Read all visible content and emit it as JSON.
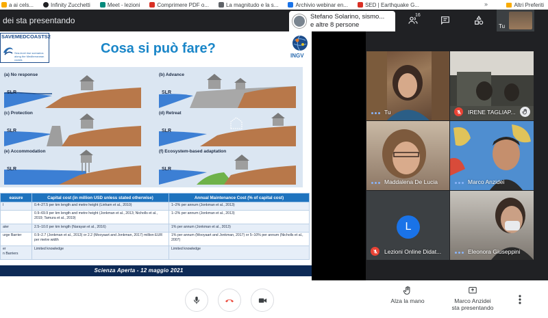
{
  "bookmarks": [
    {
      "label": "a ai cels...",
      "color": "#f9ab00"
    },
    {
      "label": "Infinity Zucchetti",
      "color": "#202124"
    },
    {
      "label": "Meet - lezioni",
      "color": "#00897b"
    },
    {
      "label": "Comprimere PDF o...",
      "color": "#d93025"
    },
    {
      "label": "La magnitudo e la s...",
      "color": "#5f6368"
    },
    {
      "label": "Archivio webinar en...",
      "color": "#1a73e8"
    },
    {
      "label": "SED | Earthquake G...",
      "color": "#d93025"
    }
  ],
  "bookmarks_more": "»",
  "bookmarks_other": "Altri Preferiti",
  "header": {
    "presenting_title": "dei sta presentando",
    "presenter_line1": "Stefano Solarino, sismo...",
    "presenter_line2": "e altre 8 persone",
    "people_count": "16",
    "self_label": "Tu"
  },
  "slide": {
    "title": "Cosa si può fare?",
    "logo_title": "SAVEMEDCOASTS2",
    "logo_sub": "Sea-level rise scenarios along the Mediterranean coasts",
    "ingv_label": "INGV",
    "panels": [
      {
        "label": "(a) No response",
        "slr": "SLR"
      },
      {
        "label": "(b) Advance",
        "slr": "SLR"
      },
      {
        "label": "(c) Protection",
        "slr": "SLR"
      },
      {
        "label": "(d) Retreat",
        "slr": "SLR"
      },
      {
        "label": "(e) Accommodation",
        "slr": "SLR"
      },
      {
        "label": "(f) Ecosystem-based adaptation",
        "slr": "SLR"
      }
    ],
    "table": {
      "headers": [
        "easure",
        "Capital cost (in million USD unless stated otherwise)",
        "Annual Maintenance Cost (% of capital cost)"
      ],
      "rows": [
        [
          "l",
          "0.4–27.5 per km length and metre height (Linham et al., 2010)",
          "1–2% per annum (Jonkman et al., 2013)"
        ],
        [
          "",
          "0.9–69.9 per km length and metre height (Jonkman et al., 2013; Nicholls et al., 2019; Tamura et al., 2019)",
          "1–2% per annum (Jonkman et al., 2013)"
        ],
        [
          "ater",
          "2.5–10.0 per km length (Narayan et al., 2016)",
          "1% per annum (Jonkman et al., 2013)"
        ],
        [
          "urge Barrier",
          "0.9–2.7 (Jonkman et al., 2013) or 2.2 (Mooyaart and Jonkman, 2017) million EUR per metre width",
          "1% per annum (Mooyaart and Jonkman, 2017) or 5–10% per annum (Nicholls et al., 2007)"
        ],
        [
          "er\nn Barriers",
          "Limited knowledge",
          "Limited knowledge"
        ]
      ]
    },
    "footer": "Scienza Aperta - 12 maggio 2021"
  },
  "participants": [
    {
      "name": "Tu",
      "state": "speaking-dots"
    },
    {
      "name": "IRENE TAGLIAP...",
      "state": "muted",
      "hand": true
    },
    {
      "name": "Maddalena De Lucia",
      "state": "speaking-dots"
    },
    {
      "name": "Marco Anzidei",
      "state": "speaking-dots"
    },
    {
      "name": "Lezioni Online Didat...",
      "state": "muted",
      "avatar_letter": "L",
      "avatar_color": "#1a73e8"
    },
    {
      "name": "Eleonora Giuseppini",
      "state": "speaking-dots"
    }
  ],
  "bottom": {
    "raise_hand": "Alza la mano",
    "presenting_line1": "Marco Anzidei",
    "presenting_line2": "sta presentando"
  },
  "colors": {
    "accent": "#1a73e8",
    "danger": "#ea4335",
    "slide_title": "#1a86c8",
    "table_header": "#1e73be"
  }
}
